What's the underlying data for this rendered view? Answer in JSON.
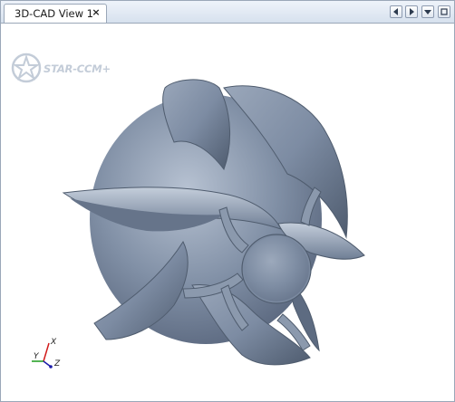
{
  "tab": {
    "title": "3D-CAD View 1",
    "close_glyph": "×"
  },
  "nav": {
    "prev_icon": "triangle-left-icon",
    "next_icon": "triangle-right-icon",
    "menu_icon": "triangle-down-icon",
    "maximize_icon": "square-icon"
  },
  "logo": {
    "text": "STAR-CCM+",
    "color": "#c3ccd8"
  },
  "model": {
    "description_icon": "impeller-model",
    "surface_color": "#7e8da3",
    "highlight_color": "#aab6c8",
    "shadow_color": "#4f5c6e"
  },
  "triad": {
    "x_label": "X",
    "y_label": "Y",
    "z_label": "Z",
    "x_color": "#d11a1a",
    "y_color": "#1a9a1a",
    "z_color": "#1a1aa8"
  }
}
